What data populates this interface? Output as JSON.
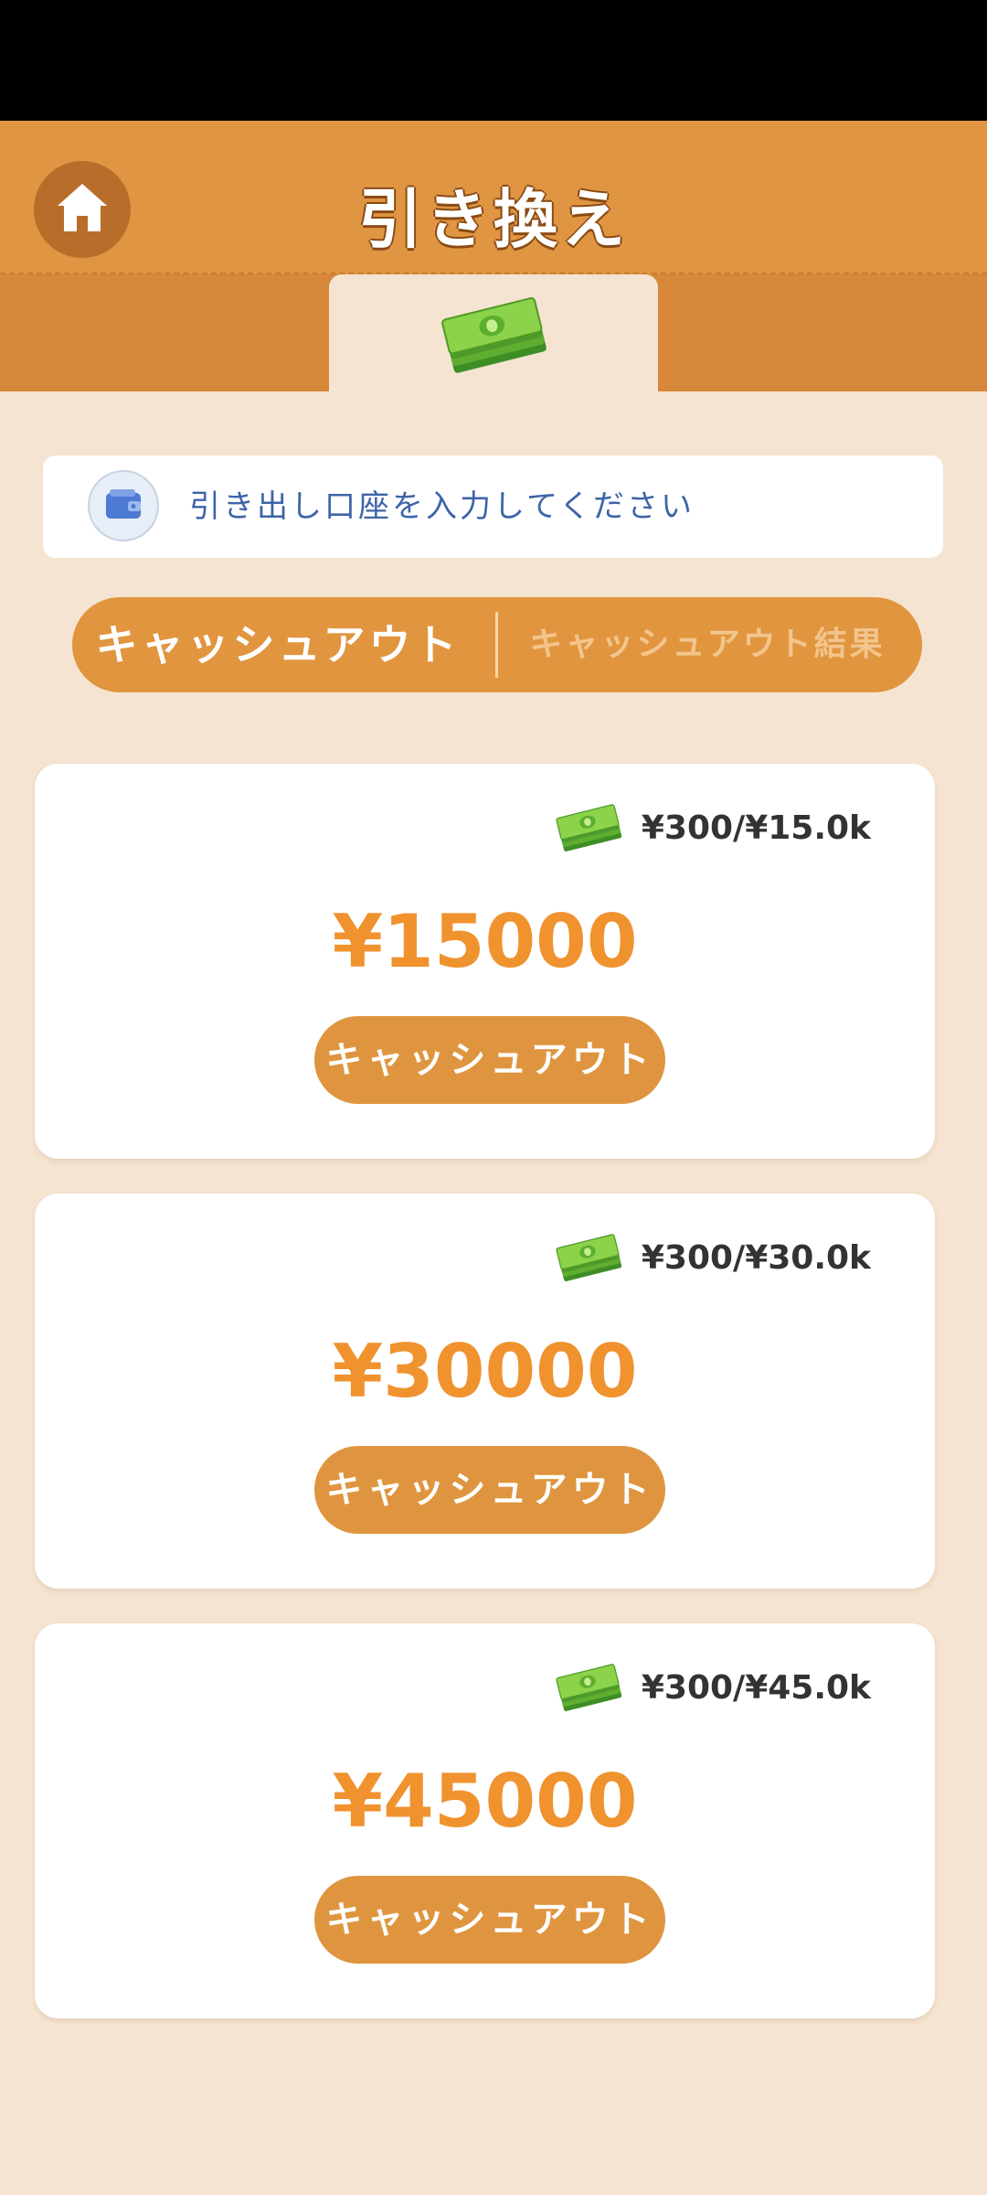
{
  "header": {
    "title": "引き換え",
    "home_icon": "home-icon",
    "currency_icon": "cash-stack-icon"
  },
  "account": {
    "icon": "wallet-icon",
    "prompt": "引き出し口座を入力してください"
  },
  "tabs": {
    "cashout": "キャッシュアウト",
    "results": "キャッシュアウト結果",
    "active": "cashout"
  },
  "cards": [
    {
      "progress": "¥300/¥15.0k",
      "amount": "¥15000",
      "button": "キャッシュアウト"
    },
    {
      "progress": "¥300/¥30.0k",
      "amount": "¥30000",
      "button": "キャッシュアウト"
    },
    {
      "progress": "¥300/¥45.0k",
      "amount": "¥45000",
      "button": "キャッシュアウト"
    }
  ],
  "colors": {
    "header_orange": "#E09542",
    "accent_orange": "#F0922E",
    "button_orange": "#DF953F",
    "background": "#F5E4D1",
    "link_blue": "#3E64A8"
  }
}
